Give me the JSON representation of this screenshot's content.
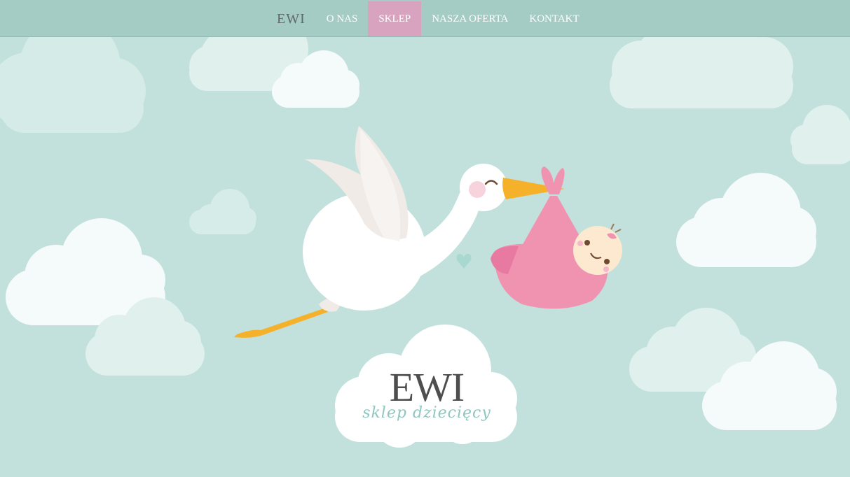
{
  "nav": {
    "brand": "EWI",
    "items": [
      {
        "label": "O NAS",
        "active": false
      },
      {
        "label": "SKLEP",
        "active": true
      },
      {
        "label": "NASZA OFERTA",
        "active": false
      },
      {
        "label": "KONTAKT",
        "active": false
      }
    ]
  },
  "hero": {
    "logo_title": "EWI",
    "logo_subtitle": "sklep dziecięcy"
  },
  "colors": {
    "background": "#c2e1dc",
    "navbar": "#a4cbc4",
    "active_item": "#d7a3bf",
    "bundle_pink": "#ef93b1",
    "beak_orange": "#f6b12b"
  }
}
